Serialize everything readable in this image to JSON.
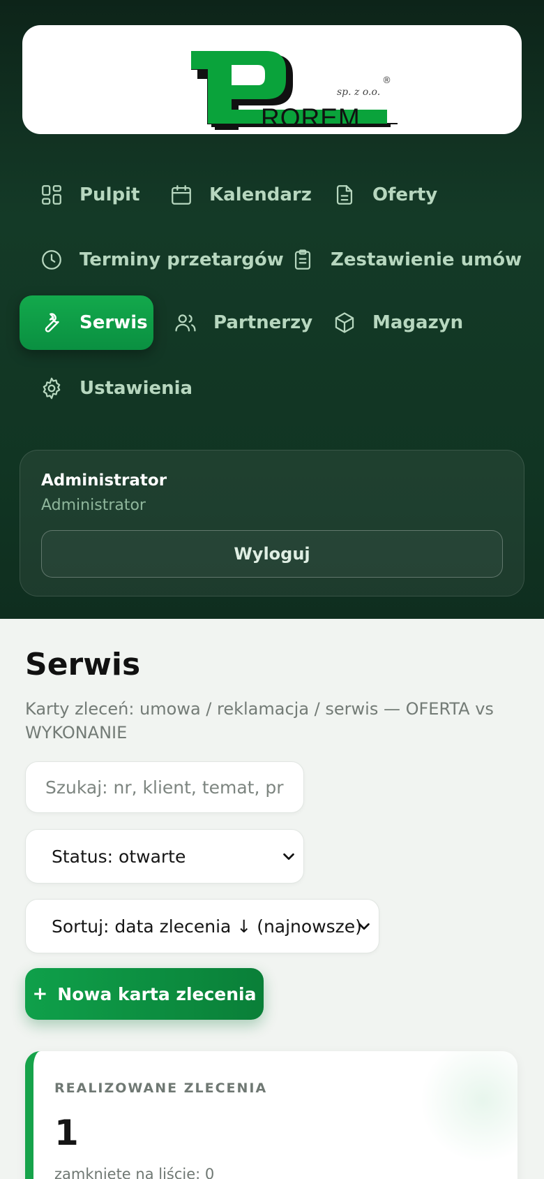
{
  "brand": {
    "logo_text": "ROREM",
    "logo_sub": "sp. z o.o.",
    "registered_mark": "®",
    "colors": {
      "green": "#0aa33b",
      "dark": "#111111"
    }
  },
  "nav": {
    "items": [
      {
        "label": "Pulpit",
        "icon": "grid-icon",
        "active": false
      },
      {
        "label": "Kalendarz",
        "icon": "calendar-icon",
        "active": false
      },
      {
        "label": "Oferty",
        "icon": "file-icon",
        "active": false
      },
      {
        "label": "Terminy przetargów",
        "icon": "clock-icon",
        "active": false
      },
      {
        "label": "Zestawienie umów",
        "icon": "clipboard-icon",
        "active": false
      },
      {
        "label": "Serwis",
        "icon": "wrench-icon",
        "active": true
      },
      {
        "label": "Partnerzy",
        "icon": "users-icon",
        "active": false
      },
      {
        "label": "Magazyn",
        "icon": "box-icon",
        "active": false
      },
      {
        "label": "Ustawienia",
        "icon": "gear-icon",
        "active": false
      }
    ]
  },
  "user": {
    "name": "Administrator",
    "role": "Administrator",
    "logout_label": "Wyloguj"
  },
  "page": {
    "title": "Serwis",
    "subtitle": "Karty zleceń: umowa / reklamacja / serwis — OFERTA vs WYKONANIE"
  },
  "filters": {
    "search_placeholder": "Szukaj: nr, klient, temat, pr",
    "status_value": "Status: otwarte",
    "sort_value": "Sortuj: data zlecenia ↓ (najnowsze)"
  },
  "actions": {
    "new_order_plus": "+",
    "new_order_label": "Nowa karta zlecenia"
  },
  "stats": {
    "label": "REALIZOWANE ZLECENIA",
    "value": "1",
    "note": "zamknięte na liście: 0"
  },
  "colors": {
    "accent": "#16a34a",
    "sidebar_bg": "#143a27",
    "nav_text": "#b7d7bf"
  }
}
